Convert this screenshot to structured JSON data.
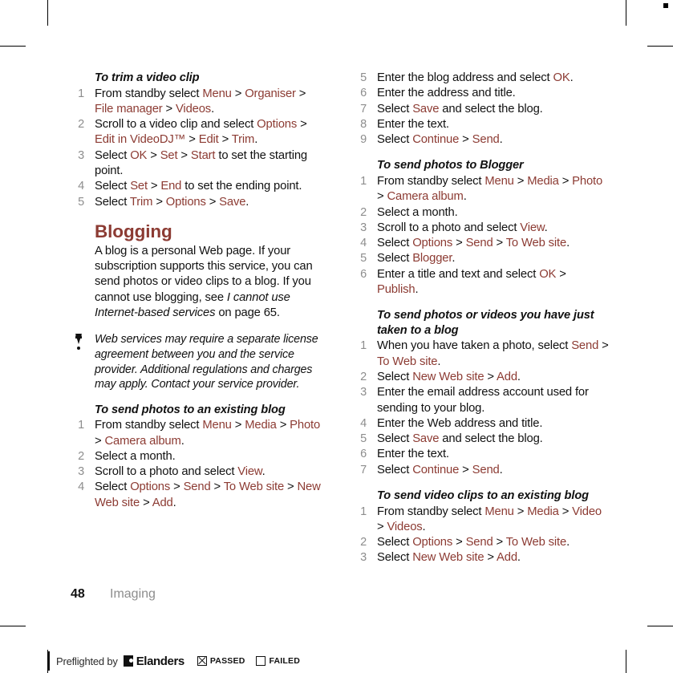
{
  "page": {
    "number": "48",
    "section": "Imaging"
  },
  "left_column": {
    "procedures": [
      {
        "title": "To trim a video clip",
        "steps": [
          [
            {
              "t": "From standby select ",
              "s": "plain"
            },
            {
              "t": "Menu",
              "s": "ui"
            },
            {
              "t": " > ",
              "s": "plain"
            },
            {
              "t": "Organiser",
              "s": "ui"
            },
            {
              "t": " > ",
              "s": "plain"
            },
            {
              "t": "File manager",
              "s": "ui"
            },
            {
              "t": " > ",
              "s": "plain"
            },
            {
              "t": "Videos",
              "s": "ui"
            },
            {
              "t": ".",
              "s": "plain"
            }
          ],
          [
            {
              "t": "Scroll to a video clip and select ",
              "s": "plain"
            },
            {
              "t": "Options",
              "s": "ui"
            },
            {
              "t": " > ",
              "s": "plain"
            },
            {
              "t": "Edit in VideoDJ™",
              "s": "ui"
            },
            {
              "t": " > ",
              "s": "plain"
            },
            {
              "t": "Edit",
              "s": "ui"
            },
            {
              "t": " > ",
              "s": "plain"
            },
            {
              "t": "Trim",
              "s": "ui"
            },
            {
              "t": ".",
              "s": "plain"
            }
          ],
          [
            {
              "t": "Select ",
              "s": "plain"
            },
            {
              "t": "OK",
              "s": "ui"
            },
            {
              "t": " > ",
              "s": "plain"
            },
            {
              "t": "Set",
              "s": "ui"
            },
            {
              "t": " > ",
              "s": "plain"
            },
            {
              "t": "Start",
              "s": "ui"
            },
            {
              "t": " to set the starting point.",
              "s": "plain"
            }
          ],
          [
            {
              "t": "Select ",
              "s": "plain"
            },
            {
              "t": "Set",
              "s": "ui"
            },
            {
              "t": " > ",
              "s": "plain"
            },
            {
              "t": "End",
              "s": "ui"
            },
            {
              "t": " to set the ending point.",
              "s": "plain"
            }
          ],
          [
            {
              "t": "Select ",
              "s": "plain"
            },
            {
              "t": "Trim",
              "s": "ui"
            },
            {
              "t": " > ",
              "s": "plain"
            },
            {
              "t": "Options",
              "s": "ui"
            },
            {
              "t": " > ",
              "s": "plain"
            },
            {
              "t": "Save",
              "s": "ui"
            },
            {
              "t": ".",
              "s": "plain"
            }
          ]
        ]
      }
    ],
    "section_heading": "Blogging",
    "intro_paragraph": [
      {
        "t": "A blog is a personal Web page. If your subscription supports this service, you can send photos or video clips to a blog. If you cannot use blogging, see ",
        "s": "plain"
      },
      {
        "t": "I cannot use Internet-based services",
        "s": "italic"
      },
      {
        "t": " on page 65.",
        "s": "plain"
      }
    ],
    "note": "Web services may require a separate license agreement between you and the service provider. Additional regulations and charges may apply. Contact your service provider.",
    "note_icon": "exclamation-icon",
    "procedures_2": [
      {
        "title": "To send photos to an existing blog",
        "steps": [
          [
            {
              "t": "From standby select ",
              "s": "plain"
            },
            {
              "t": "Menu",
              "s": "ui"
            },
            {
              "t": " > ",
              "s": "plain"
            },
            {
              "t": "Media",
              "s": "ui"
            },
            {
              "t": " > ",
              "s": "plain"
            },
            {
              "t": "Photo",
              "s": "ui"
            },
            {
              "t": " > ",
              "s": "plain"
            },
            {
              "t": "Camera album",
              "s": "ui"
            },
            {
              "t": ".",
              "s": "plain"
            }
          ],
          [
            {
              "t": "Select a month.",
              "s": "plain"
            }
          ],
          [
            {
              "t": "Scroll to a photo and select ",
              "s": "plain"
            },
            {
              "t": "View",
              "s": "ui"
            },
            {
              "t": ".",
              "s": "plain"
            }
          ],
          [
            {
              "t": "Select ",
              "s": "plain"
            },
            {
              "t": "Options",
              "s": "ui"
            },
            {
              "t": " > ",
              "s": "plain"
            },
            {
              "t": "Send",
              "s": "ui"
            },
            {
              "t": " > ",
              "s": "plain"
            },
            {
              "t": "To Web site",
              "s": "ui"
            },
            {
              "t": " > ",
              "s": "plain"
            },
            {
              "t": "New Web site",
              "s": "ui"
            },
            {
              "t": " > ",
              "s": "plain"
            },
            {
              "t": "Add",
              "s": "ui"
            },
            {
              "t": ".",
              "s": "plain"
            }
          ]
        ]
      }
    ]
  },
  "right_column": {
    "continued_steps": {
      "start_number": 5,
      "steps": [
        [
          {
            "t": "Enter the blog address and select ",
            "s": "plain"
          },
          {
            "t": "OK",
            "s": "ui"
          },
          {
            "t": ".",
            "s": "plain"
          }
        ],
        [
          {
            "t": "Enter the address and title.",
            "s": "plain"
          }
        ],
        [
          {
            "t": "Select ",
            "s": "plain"
          },
          {
            "t": "Save",
            "s": "ui"
          },
          {
            "t": " and select the blog.",
            "s": "plain"
          }
        ],
        [
          {
            "t": "Enter the text.",
            "s": "plain"
          }
        ],
        [
          {
            "t": "Select ",
            "s": "plain"
          },
          {
            "t": "Continue",
            "s": "ui"
          },
          {
            "t": " > ",
            "s": "plain"
          },
          {
            "t": "Send",
            "s": "ui"
          },
          {
            "t": ".",
            "s": "plain"
          }
        ]
      ]
    },
    "procedures": [
      {
        "title": "To send photos to Blogger",
        "steps": [
          [
            {
              "t": "From standby select ",
              "s": "plain"
            },
            {
              "t": "Menu",
              "s": "ui"
            },
            {
              "t": " > ",
              "s": "plain"
            },
            {
              "t": "Media",
              "s": "ui"
            },
            {
              "t": " > ",
              "s": "plain"
            },
            {
              "t": "Photo",
              "s": "ui"
            },
            {
              "t": " > ",
              "s": "plain"
            },
            {
              "t": "Camera album",
              "s": "ui"
            },
            {
              "t": ".",
              "s": "plain"
            }
          ],
          [
            {
              "t": "Select a month.",
              "s": "plain"
            }
          ],
          [
            {
              "t": "Scroll to a photo and select ",
              "s": "plain"
            },
            {
              "t": "View",
              "s": "ui"
            },
            {
              "t": ".",
              "s": "plain"
            }
          ],
          [
            {
              "t": "Select ",
              "s": "plain"
            },
            {
              "t": "Options",
              "s": "ui"
            },
            {
              "t": " > ",
              "s": "plain"
            },
            {
              "t": "Send",
              "s": "ui"
            },
            {
              "t": " > ",
              "s": "plain"
            },
            {
              "t": "To Web site",
              "s": "ui"
            },
            {
              "t": ".",
              "s": "plain"
            }
          ],
          [
            {
              "t": "Select ",
              "s": "plain"
            },
            {
              "t": "Blogger",
              "s": "ui"
            },
            {
              "t": ".",
              "s": "plain"
            }
          ],
          [
            {
              "t": "Enter a title and text and select ",
              "s": "plain"
            },
            {
              "t": "OK",
              "s": "ui"
            },
            {
              "t": " > ",
              "s": "plain"
            },
            {
              "t": "Publish",
              "s": "ui"
            },
            {
              "t": ".",
              "s": "plain"
            }
          ]
        ]
      },
      {
        "title": "To send photos or videos you have just taken to a blog",
        "steps": [
          [
            {
              "t": "When you have taken a photo, select ",
              "s": "plain"
            },
            {
              "t": "Send",
              "s": "ui"
            },
            {
              "t": " > ",
              "s": "plain"
            },
            {
              "t": "To Web site",
              "s": "ui"
            },
            {
              "t": ".",
              "s": "plain"
            }
          ],
          [
            {
              "t": "Select ",
              "s": "plain"
            },
            {
              "t": "New Web site",
              "s": "ui"
            },
            {
              "t": " > ",
              "s": "plain"
            },
            {
              "t": "Add",
              "s": "ui"
            },
            {
              "t": ".",
              "s": "plain"
            }
          ],
          [
            {
              "t": "Enter the email address account used for sending to your blog.",
              "s": "plain"
            }
          ],
          [
            {
              "t": "Enter the Web address and title.",
              "s": "plain"
            }
          ],
          [
            {
              "t": "Select ",
              "s": "plain"
            },
            {
              "t": "Save",
              "s": "ui"
            },
            {
              "t": " and select the blog.",
              "s": "plain"
            }
          ],
          [
            {
              "t": "Enter the text.",
              "s": "plain"
            }
          ],
          [
            {
              "t": "Select ",
              "s": "plain"
            },
            {
              "t": "Continue",
              "s": "ui"
            },
            {
              "t": " > ",
              "s": "plain"
            },
            {
              "t": "Send",
              "s": "ui"
            },
            {
              "t": ".",
              "s": "plain"
            }
          ]
        ]
      },
      {
        "title": "To send video clips to an existing blog",
        "steps": [
          [
            {
              "t": "From standby select ",
              "s": "plain"
            },
            {
              "t": "Menu",
              "s": "ui"
            },
            {
              "t": " > ",
              "s": "plain"
            },
            {
              "t": "Media",
              "s": "ui"
            },
            {
              "t": " > ",
              "s": "plain"
            },
            {
              "t": "Video",
              "s": "ui"
            },
            {
              "t": " > ",
              "s": "plain"
            },
            {
              "t": "Videos",
              "s": "ui"
            },
            {
              "t": ".",
              "s": "plain"
            }
          ],
          [
            {
              "t": "Select ",
              "s": "plain"
            },
            {
              "t": "Options",
              "s": "ui"
            },
            {
              "t": " > ",
              "s": "plain"
            },
            {
              "t": "Send",
              "s": "ui"
            },
            {
              "t": " > ",
              "s": "plain"
            },
            {
              "t": "To Web site",
              "s": "ui"
            },
            {
              "t": ".",
              "s": "plain"
            }
          ],
          [
            {
              "t": "Select ",
              "s": "plain"
            },
            {
              "t": "New Web site",
              "s": "ui"
            },
            {
              "t": " > ",
              "s": "plain"
            },
            {
              "t": "Add",
              "s": "ui"
            },
            {
              "t": ".",
              "s": "plain"
            }
          ]
        ]
      }
    ]
  },
  "preflight": {
    "text": "Preflighted by",
    "brand": "Elanders",
    "passed_label": "PASSED",
    "failed_label": "FAILED",
    "passed_checked": true,
    "failed_checked": false
  },
  "colors": {
    "accent": "#8C3B33",
    "body": "#111111",
    "muted": "#8d8d8d"
  }
}
